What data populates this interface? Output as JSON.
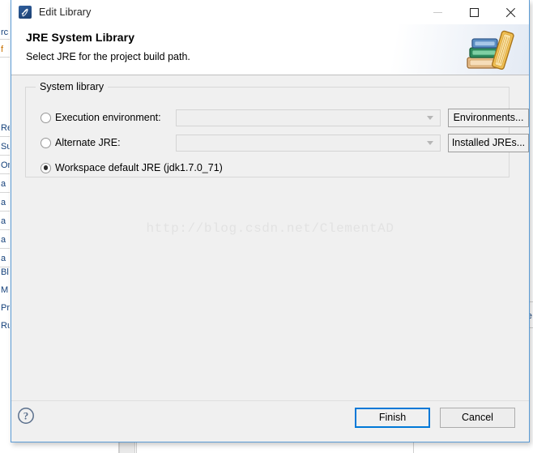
{
  "window": {
    "title": "Edit Library",
    "icon": "java-library-icon",
    "controls": {
      "minimize": "minimize-icon",
      "maximize": "maximize-icon",
      "close": "close-icon"
    }
  },
  "header": {
    "title": "JRE System Library",
    "subtitle": "Select JRE for the project build path.",
    "banner_icon": "books-stack-icon"
  },
  "group": {
    "legend": "System library",
    "rows": [
      {
        "id": "execution-environment",
        "label": "Execution environment:",
        "selected": false,
        "combo_value": "",
        "button": "Environments..."
      },
      {
        "id": "alternate-jre",
        "label": "Alternate JRE:",
        "selected": false,
        "combo_value": "",
        "button": "Installed JREs..."
      },
      {
        "id": "workspace-default-jre",
        "label": "Workspace default JRE (jdk1.7.0_71)",
        "selected": true
      }
    ]
  },
  "watermark": {
    "text": "http://blog.csdn.net/ClementAD"
  },
  "footer": {
    "help_icon": "help-question-icon",
    "finish_label": "Finish",
    "cancel_label": "Cancel"
  },
  "background": {
    "left_fragments": [
      "rc",
      "f",
      "Re",
      "Su",
      "Or",
      "a",
      "a",
      "a",
      "a",
      "a",
      "Bl",
      "M",
      "Pr",
      "Ru"
    ],
    "right_fragment": "de"
  },
  "colors": {
    "accent": "#0078d7",
    "dialog_border": "#5b9bd5",
    "panel": "#f0f0f0",
    "header_bg": "#ffffff",
    "watermark": "#e2e2e2"
  }
}
